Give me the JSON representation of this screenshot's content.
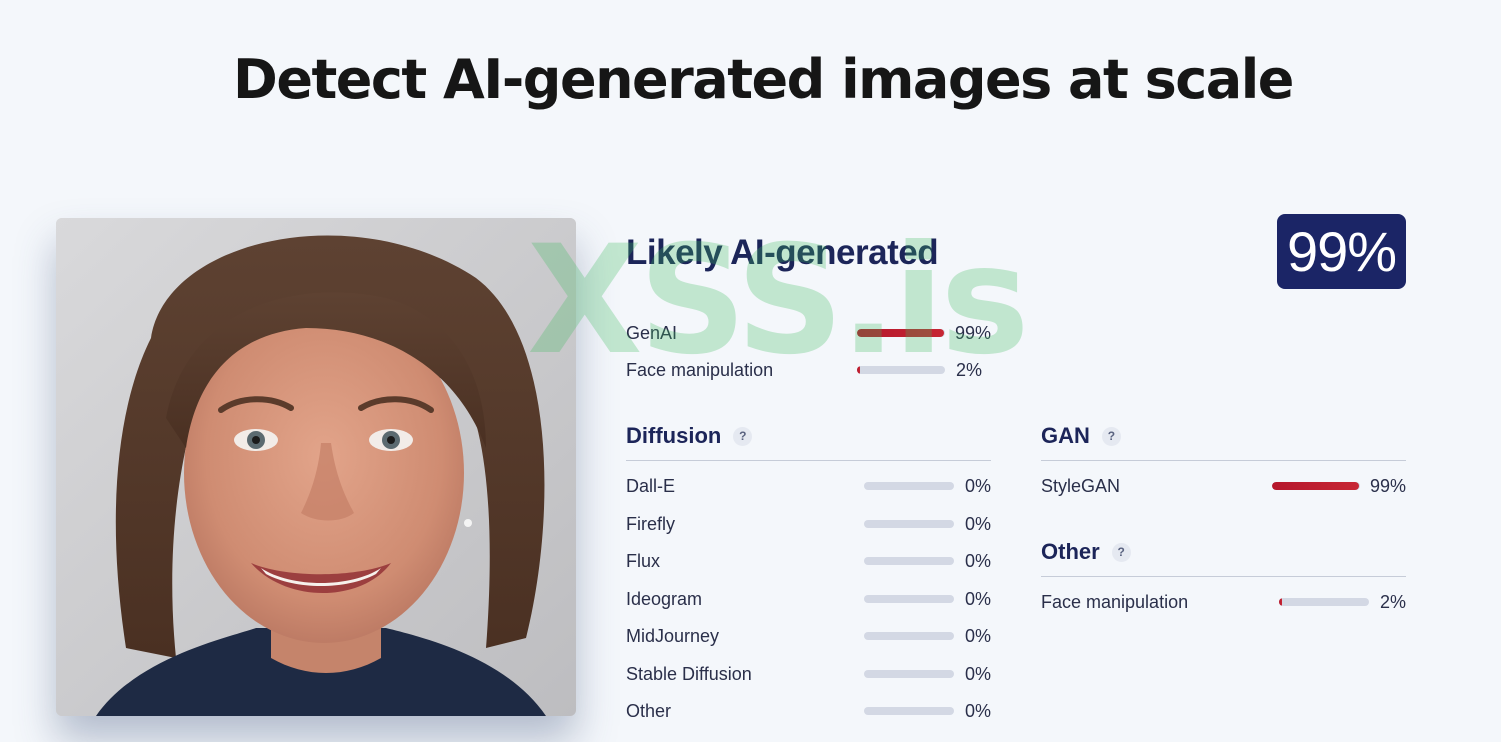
{
  "headline": "Detect AI-generated images at scale",
  "verdict": "Likely AI-generated",
  "score": "99%",
  "watermark": "XSS.is",
  "summary": [
    {
      "label": "GenAI",
      "value": 0.99,
      "pct": "99%"
    },
    {
      "label": "Face manipulation",
      "value": 0.02,
      "pct": "2%"
    }
  ],
  "diffusion": {
    "title": "Diffusion",
    "help": "?",
    "items": [
      {
        "label": "Dall-E",
        "value": 0,
        "pct": "0%"
      },
      {
        "label": "Firefly",
        "value": 0,
        "pct": "0%"
      },
      {
        "label": "Flux",
        "value": 0,
        "pct": "0%"
      },
      {
        "label": "Ideogram",
        "value": 0,
        "pct": "0%"
      },
      {
        "label": "MidJourney",
        "value": 0,
        "pct": "0%"
      },
      {
        "label": "Stable Diffusion",
        "value": 0,
        "pct": "0%"
      },
      {
        "label": "Other",
        "value": 0,
        "pct": "0%"
      }
    ]
  },
  "gan": {
    "title": "GAN",
    "help": "?",
    "items": [
      {
        "label": "StyleGAN",
        "value": 0.99,
        "pct": "99%"
      }
    ]
  },
  "other": {
    "title": "Other",
    "help": "?",
    "items": [
      {
        "label": "Face manipulation",
        "value": 0.02,
        "pct": "2%"
      }
    ]
  },
  "colors": {
    "accent": "#1b2566",
    "bar_fill": "#c1202f",
    "bar_track": "#d3d8e4",
    "background": "#f4f7fb"
  }
}
